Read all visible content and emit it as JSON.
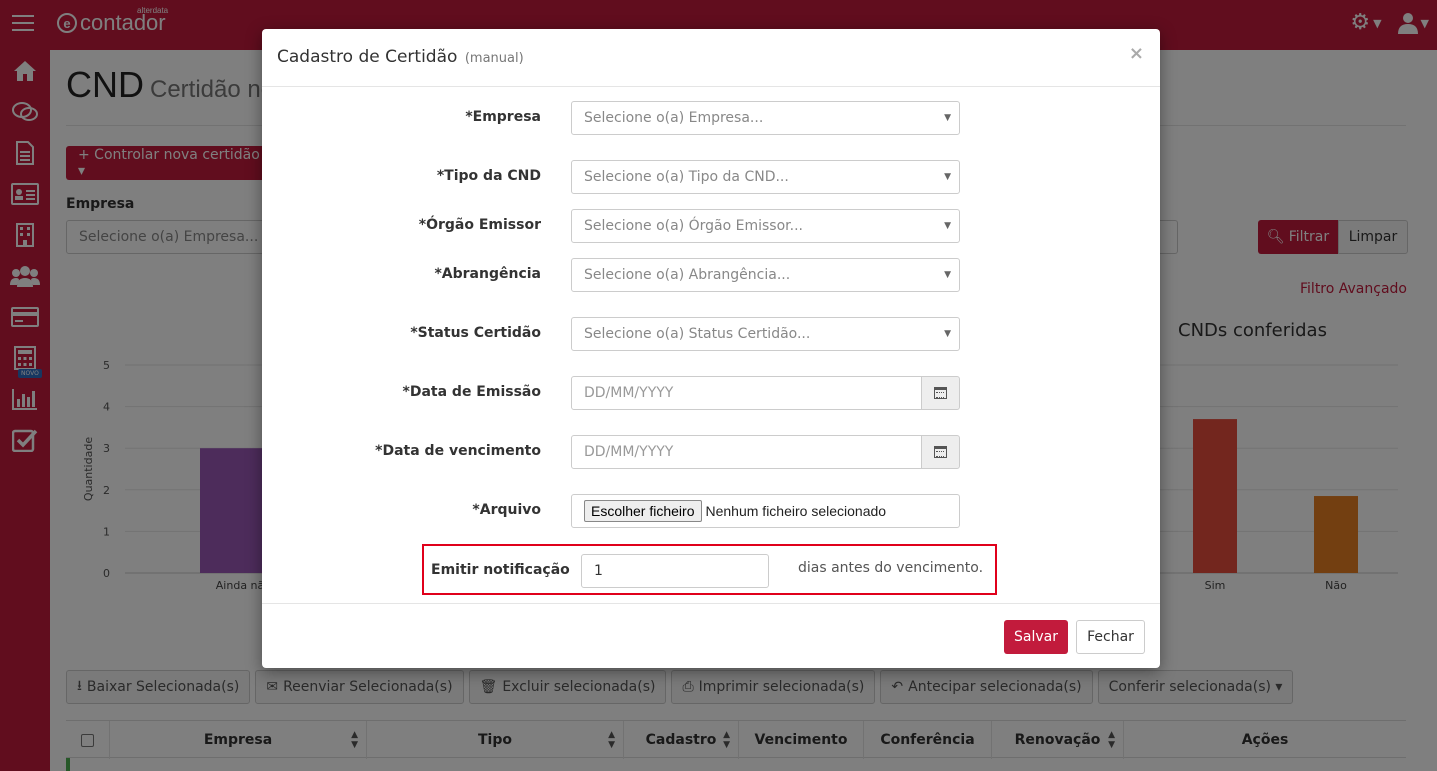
{
  "app": {
    "logo_text": "contador",
    "logo_small": "alterdata"
  },
  "sidebar": {
    "novo_badge": "NOVO"
  },
  "page": {
    "title": "CND",
    "subtitle": "Certidão ne",
    "new_button": "+ Controlar nova certidão ▾",
    "empresa_label": "Empresa",
    "empresa_placeholder": "Selecione o(a) Empresa...",
    "filter_button": "Filtrar",
    "clear_button": "Limpar",
    "advanced_filter": "Filtro Avançado",
    "chart_right_title": "CNDs conferidas"
  },
  "chart_data": {
    "type": "bar",
    "ylabel": "Quantidade",
    "ylim": [
      0,
      5
    ],
    "y_ticks": [
      "0",
      "1",
      "2",
      "3",
      "4",
      "5"
    ],
    "left": {
      "categories": [
        "Ainda não ba"
      ],
      "values": [
        3
      ],
      "colors": [
        "#9b59b6"
      ]
    },
    "right": {
      "categories": [
        "Sim",
        "Não"
      ],
      "values": [
        3.7,
        1.85
      ],
      "colors": [
        "#e74c3c",
        "#e67e22"
      ]
    }
  },
  "actions": {
    "download": "Baixar Selecionada(s)",
    "resend": "Reenviar Selecionada(s)",
    "delete": "Excluir selecionada(s)",
    "print": "Imprimir selecionada(s)",
    "anticipate": "Antecipar selecionada(s)",
    "check": "Conferir selecionada(s) ▾"
  },
  "table": {
    "headers": [
      "Empresa",
      "Tipo",
      "Cadastro",
      "Vencimento",
      "Conferência",
      "Renovação",
      "Ações"
    ]
  },
  "modal": {
    "title": "Cadastro de Certidão",
    "title_suffix": "(manual)",
    "close": "×",
    "fields": {
      "empresa_label": "*Empresa",
      "empresa_placeholder": "Selecione o(a) Empresa...",
      "tipo_label": "*Tipo da CND",
      "tipo_placeholder": "Selecione o(a) Tipo da CND...",
      "orgao_label": "*Órgão Emissor",
      "orgao_placeholder": "Selecione o(a) Órgão Emissor...",
      "abrangencia_label": "*Abrangência",
      "abrangencia_placeholder": "Selecione o(a) Abrangência...",
      "status_label": "*Status Certidão",
      "status_placeholder": "Selecione o(a) Status Certidão...",
      "emissao_label": "*Data de Emissão",
      "emissao_placeholder": "DD/MM/YYYY",
      "vencimento_label": "*Data de vencimento",
      "vencimento_placeholder": "DD/MM/YYYY",
      "arquivo_label": "*Arquivo",
      "arquivo_button": "Escolher ficheiro",
      "arquivo_status": "Nenhum ficheiro selecionado",
      "notificacao_label": "Emitir notificação",
      "notificacao_value": "1",
      "notificacao_suffix": "dias antes do vencimento."
    },
    "save": "Salvar",
    "close_button": "Fechar"
  },
  "colors": {
    "brand": "#c21b3c",
    "highlight_border": "#e0001b"
  }
}
